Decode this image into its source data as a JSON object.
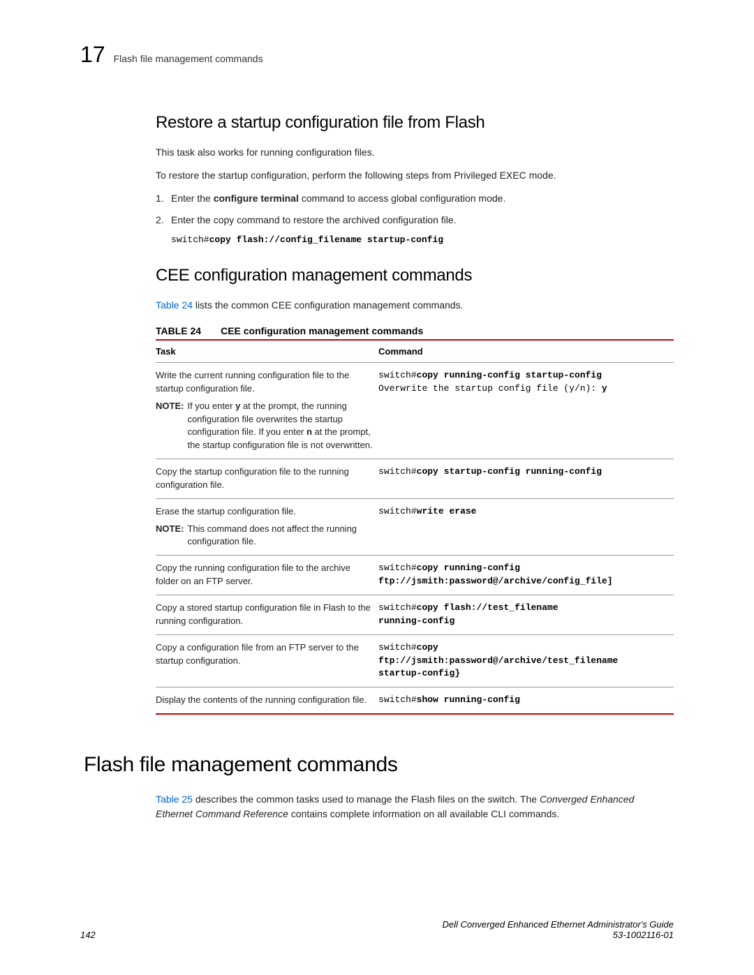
{
  "header": {
    "chapterNum": "17",
    "chapterTitle": "Flash file management commands"
  },
  "section1": {
    "heading": "Restore a startup configuration file from Flash",
    "p1": "This task also works for running configuration files.",
    "p2": "To restore the startup configuration, perform the following steps from Privileged EXEC mode.",
    "step1_num": "1.",
    "step1_pre": "Enter the ",
    "step1_bold": "configure terminal",
    "step1_post": " command to access global configuration mode.",
    "step2_num": "2.",
    "step2_text": "Enter the copy command to restore the archived configuration file.",
    "code_prefix": "switch#",
    "code_bold": "copy flash://config_filename startup-config"
  },
  "section2": {
    "heading": "CEE configuration management commands",
    "link": "Table 24",
    "p1_rest": " lists the common CEE configuration management commands.",
    "tableLabel": "TABLE 24",
    "tableCaption": "CEE configuration management commands",
    "colTask": "Task",
    "colCommand": "Command",
    "row1_task_main": "Write the current running configuration file to the startup configuration file.",
    "row1_note_pre": "If you enter ",
    "row1_note_b1": "y",
    "row1_note_mid1": " at the prompt, the running configuration file overwrites the startup configuration file. If you enter ",
    "row1_note_b2": "n",
    "row1_note_mid2": " at the prompt, the startup configuration file is not overwritten.",
    "row1_cmd_pre": "switch#",
    "row1_cmd_bold": "copy running-config startup-config",
    "row1_cmd_line2_pre": "Overwrite the startup config file (y/n): ",
    "row1_cmd_line2_bold": "y",
    "row2_task": "Copy the startup configuration file to the running configuration file.",
    "row2_cmd_pre": "switch#",
    "row2_cmd_bold": "copy startup-config running-config",
    "row3_task_main": "Erase the startup configuration file.",
    "row3_note": "This command does not affect the running configuration file.",
    "row3_cmd_pre": "switch#",
    "row3_cmd_bold": "write erase",
    "row4_task": "Copy the running configuration file to the archive folder on an FTP server.",
    "row4_cmd_pre": "switch#",
    "row4_cmd_bold1": "copy running-config",
    "row4_cmd_bold2": "ftp://jsmith:password@/archive/config_file]",
    "row5_task": "Copy a stored startup configuration file in Flash to the running configuration.",
    "row5_cmd_pre": "switch#",
    "row5_cmd_bold1": "copy flash://test_filename",
    "row5_cmd_bold2": "running-config",
    "row6_task": "Copy a configuration file from an FTP server to the startup configuration.",
    "row6_cmd_pre": "switch#",
    "row6_cmd_bold1": "copy",
    "row6_cmd_bold2": "ftp://jsmith:password@/archive/test_filename",
    "row6_cmd_bold3": "startup-config}",
    "row7_task": "Display the contents of the running configuration file.",
    "row7_cmd_pre": "switch#",
    "row7_cmd_bold": "show running-config"
  },
  "section3": {
    "heading": "Flash file management commands",
    "link": "Table 25",
    "p1_mid": " describes the common tasks used to manage the Flash files on the switch. The ",
    "p1_italic": "Converged Enhanced Ethernet Command Reference",
    "p1_end": " contains complete information on all available CLI commands."
  },
  "footer": {
    "pageNum": "142",
    "guideTitle": "Dell Converged Enhanced Ethernet Administrator's Guide",
    "docId": "53-1002116-01"
  },
  "labels": {
    "note": "NOTE:"
  }
}
